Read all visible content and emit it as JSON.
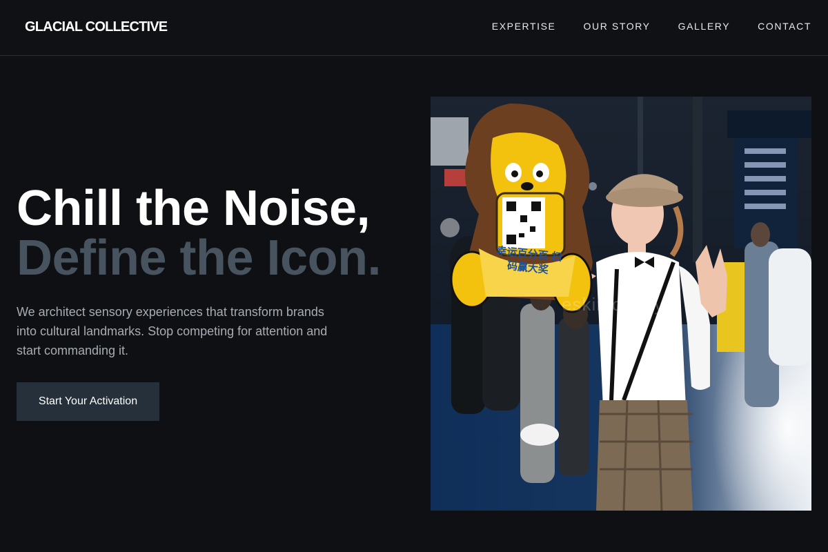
{
  "nav": {
    "brand": "GLACIAL COLLECTIVE",
    "links": [
      "EXPERTISE",
      "OUR STORY",
      "GALLERY",
      "CONTACT"
    ]
  },
  "hero": {
    "title_line1": "Chill the Noise,",
    "title_line2": "Define the Icon.",
    "description": "We architect sensory experiences that transform brands into cultural landmarks. Stop competing for attention and start commanding it.",
    "cta_label": "Start Your Activation"
  },
  "photo": {
    "watermark": "eskimo.tokyo",
    "sign_text": "幸运百分百 扫码赢大奖"
  },
  "colors": {
    "background": "#0e1013",
    "title_primary": "#ffffff",
    "title_secondary": "#47545f",
    "cta_background": "#25303a"
  }
}
